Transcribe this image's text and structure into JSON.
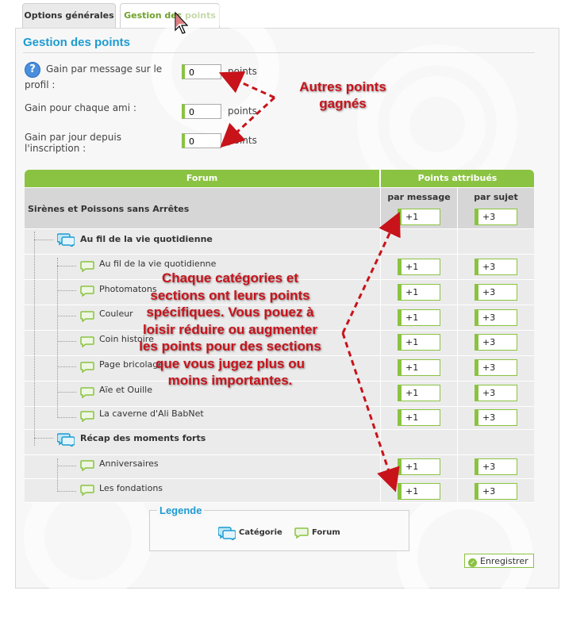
{
  "tabs": [
    {
      "label": "Options générales",
      "active": false
    },
    {
      "label": "Gestion des points",
      "active": true
    }
  ],
  "section_title": "Gestion des points",
  "fields": [
    {
      "label_line1": "Gain par message sur le",
      "label_line2": "profil :",
      "value": "0",
      "unit": "points"
    },
    {
      "label_line1": "Gain pour chaque ami :",
      "label_line2": "",
      "value": "0",
      "unit": "points"
    },
    {
      "label_line1": "Gain par jour depuis",
      "label_line2": "l'inscription :",
      "value": "0",
      "unit": "points"
    }
  ],
  "annotations": {
    "top_line1": "Autres points",
    "top_line2": "gagnés",
    "main_lines": [
      "Chaque catégories et",
      "sections ont leurs points",
      "spécifiques. Vous pouez à",
      "loisir réduire ou augmenter",
      "les points pour des sections",
      "que vous jugez plus ou",
      "moins importantes."
    ]
  },
  "table": {
    "col_forum": "Forum",
    "col_points": "Points attribués",
    "sub_message": "par message",
    "sub_subject": "par sujet",
    "root": {
      "name": "Sirènes et Poissons sans Arrêtes",
      "message": "+1",
      "subject": "+3"
    },
    "rows": [
      {
        "type": "category",
        "name": "Au fil de la vie quotidienne"
      },
      {
        "type": "forum",
        "name": "Au fil de la vie quotidienne",
        "message": "+1",
        "subject": "+3"
      },
      {
        "type": "forum",
        "name": "Photomatons",
        "message": "+1",
        "subject": "+3"
      },
      {
        "type": "forum",
        "name": "Couleur",
        "message": "+1",
        "subject": "+3"
      },
      {
        "type": "forum",
        "name": "Coin histoire",
        "message": "+1",
        "subject": "+3"
      },
      {
        "type": "forum",
        "name": "Page bricolage",
        "message": "+1",
        "subject": "+3"
      },
      {
        "type": "forum",
        "name": "Aïe et Ouille",
        "message": "+1",
        "subject": "+3"
      },
      {
        "type": "forum",
        "name": "La caverne d'Ali BabNet",
        "message": "+1",
        "subject": "+3"
      },
      {
        "type": "category",
        "name": "Récap des moments forts"
      },
      {
        "type": "forum",
        "name": "Anniversaires",
        "message": "+1",
        "subject": "+3"
      },
      {
        "type": "forum",
        "name": "Les fondations",
        "message": "+1",
        "subject": "+3"
      }
    ]
  },
  "legend": {
    "title": "Legende",
    "category": "Catégorie",
    "forum": "Forum"
  },
  "save_label": "Enregistrer",
  "colors": {
    "accent_green": "#8ac341",
    "title_blue": "#1d9bd1",
    "annotation_red": "#c8131b"
  }
}
